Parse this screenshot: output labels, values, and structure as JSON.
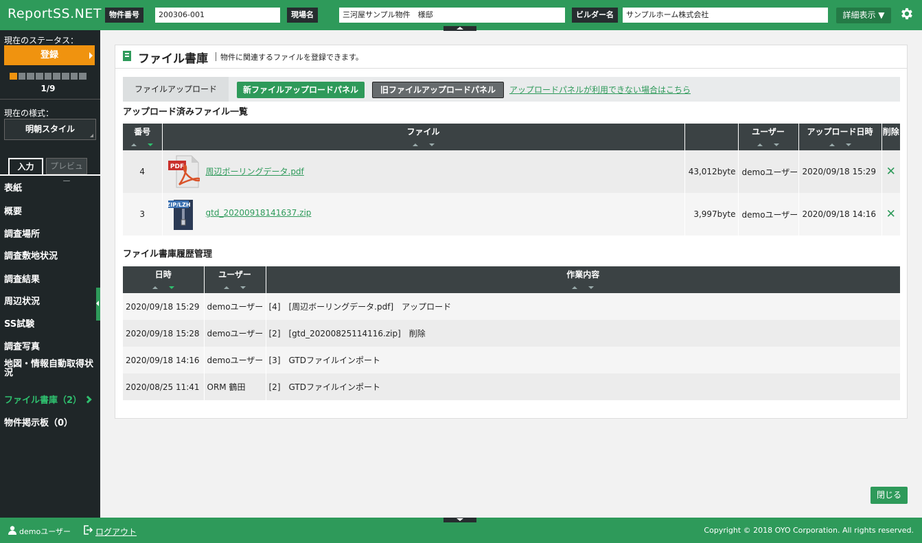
{
  "app": {
    "logo": "ReportSS.NET"
  },
  "header": {
    "property_no_label": "物件番号",
    "property_no_value": "200306-001",
    "site_name_label": "現場名",
    "site_name_value": "三河屋サンプル物件　様邸",
    "builder_label": "ビルダー名",
    "builder_value": "サンプルホーム株式会社",
    "detail_button": "詳細表示 ▼",
    "settings_icon": "gear-icon"
  },
  "sidebar": {
    "status_label": "現在のステータス：",
    "status_value": "登録",
    "progress": {
      "current": 1,
      "total": 9,
      "text": "1/9"
    },
    "style_label": "現在の様式：",
    "style_value": "明朝スタイル",
    "tab_input": "入力",
    "tab_preview": "プレビュー",
    "nav": [
      "表紙",
      "概要",
      "調査場所",
      "調査敷地状況",
      "調査結果",
      "周辺状況",
      "SS試験",
      "調査写真",
      "地図・情報自動取得状況",
      "ファイル書庫（2）",
      "物件掲示板（0）"
    ],
    "active_index": 9
  },
  "page": {
    "title": "ファイル書庫",
    "subtitle": "物件に関連するファイルを登録できます。",
    "upload_tab": "ファイルアップロード",
    "new_panel_button": "新ファイルアップロードパネル",
    "old_panel_button": "旧ファイルアップロードパネル",
    "help_link": "アップロードパネルが利用できない場合はこちら",
    "files_title": "アップロード済みファイル一覧",
    "files_columns": [
      "番号",
      "ファイル",
      "ユーザー",
      "アップロード日時",
      "削除"
    ],
    "files": [
      {
        "no": "4",
        "icon": "pdf-file-icon",
        "name": "周辺ボーリングデータ.pdf",
        "size": "43,012byte",
        "user": "demoユーザー",
        "date": "2020/09/18 15:29"
      },
      {
        "no": "3",
        "icon": "zip-file-icon",
        "name": "gtd_20200918141637.zip",
        "size": "3,997byte",
        "user": "demoユーザー",
        "date": "2020/09/18 14:16"
      }
    ],
    "history_title": "ファイル書庫履歴管理",
    "history_columns": [
      "日時",
      "ユーザー",
      "作業内容"
    ],
    "history": [
      {
        "date": "2020/09/18 15:29",
        "user": "demoユーザー",
        "action": "[4]　[周辺ボーリングデータ.pdf]　アップロード"
      },
      {
        "date": "2020/09/18 15:28",
        "user": "demoユーザー",
        "action": "[2]　[gtd_20200825114116.zip]　削除"
      },
      {
        "date": "2020/09/18 14:16",
        "user": "demoユーザー",
        "action": "[3]　GTDファイルインポート"
      },
      {
        "date": "2020/08/25 11:41",
        "user": "ORM 鶴田",
        "action": "[2]　GTDファイルインポート"
      }
    ],
    "close_button": "閉じる"
  },
  "footer": {
    "user": "demoユーザー",
    "logout": "ログアウト",
    "copyright": "Copyright © 2018 OYO Corporation. All rights reserved."
  },
  "colors": {
    "brand": "#2e9a5a",
    "status": "#f0930f",
    "dark": "#1f2628"
  }
}
